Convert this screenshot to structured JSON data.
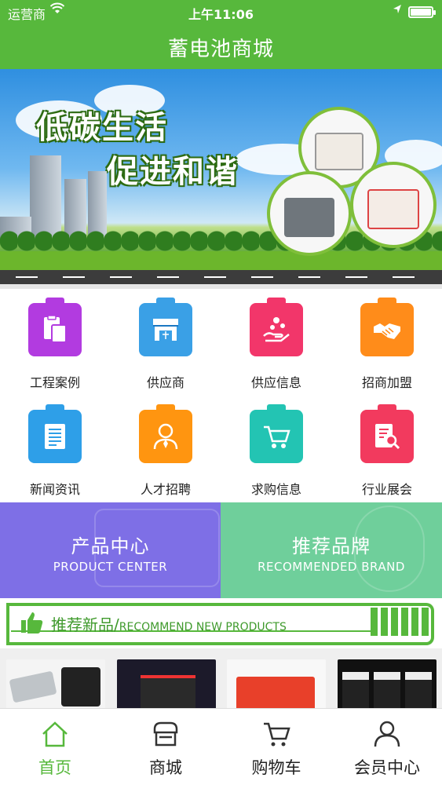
{
  "status_bar": {
    "carrier": "运营商",
    "time": "上午11:06"
  },
  "nav": {
    "title": "蓄电池商城"
  },
  "banner": {
    "slogan_line1": "低碳生活",
    "slogan_line2": "促进和谐"
  },
  "categories": [
    {
      "label": "工程案例",
      "icon": "clipboard-icon",
      "color": "#b23be0"
    },
    {
      "label": "供应商",
      "icon": "store-icon",
      "color": "#3aa0e6"
    },
    {
      "label": "供应信息",
      "icon": "hand-coins-icon",
      "color": "#f2366a"
    },
    {
      "label": "招商加盟",
      "icon": "handshake-icon",
      "color": "#ff8c1a"
    },
    {
      "label": "新闻资讯",
      "icon": "news-icon",
      "color": "#2e9fe8"
    },
    {
      "label": "人才招聘",
      "icon": "person-icon",
      "color": "#ff9510"
    },
    {
      "label": "求购信息",
      "icon": "cart-icon",
      "color": "#23c4b3"
    },
    {
      "label": "行业展会",
      "icon": "document-search-icon",
      "color": "#f23a5e"
    }
  ],
  "promos": {
    "product_center": {
      "cn": "产品中心",
      "en": "PRODUCT CENTER",
      "color": "#7e6fe6"
    },
    "recommended_brand": {
      "cn": "推荐品牌",
      "en": "RECOMMENDED BRAND",
      "color": "#6fcf9b"
    }
  },
  "recommend": {
    "cn": "推荐新品/",
    "en": "RECOMMEND NEW PRODUCTS",
    "icon": "thumbs-up-icon"
  },
  "tabbar": [
    {
      "label": "首页",
      "icon": "home-icon",
      "active": true
    },
    {
      "label": "商城",
      "icon": "shop-icon",
      "active": false
    },
    {
      "label": "购物车",
      "icon": "cart-icon",
      "active": false
    },
    {
      "label": "会员中心",
      "icon": "user-icon",
      "active": false
    }
  ],
  "colors": {
    "brand": "#57b83c",
    "accent_text": "#3f9a2c"
  }
}
